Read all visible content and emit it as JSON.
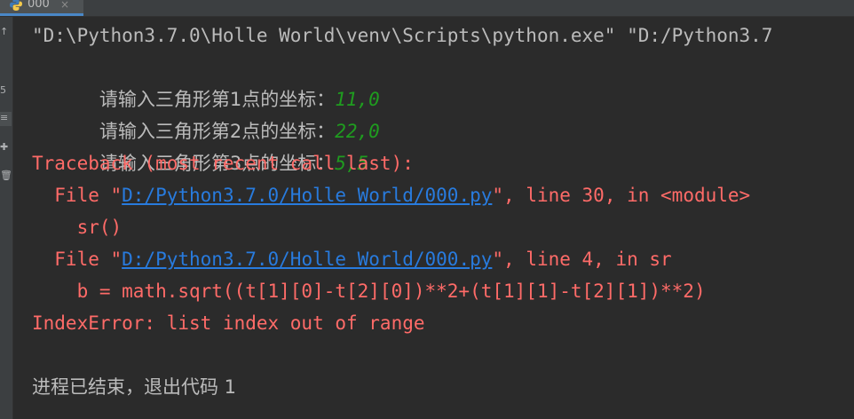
{
  "tab": {
    "label": "000",
    "close": "×",
    "icon": "python-file-icon"
  },
  "toolbar": {
    "icons": [
      "arrow-icon",
      "wrap-icon",
      "stack-icon",
      "pin-icon",
      "trash-icon"
    ],
    "glyphs": [
      "↑",
      "5",
      "≡",
      "✚",
      "🗑"
    ]
  },
  "colors": {
    "background": "#2b2b2b",
    "normal_text": "#bbbbbb",
    "input_text": "#1f9c1f",
    "error_text": "#ff6b68",
    "link": "#287bde"
  },
  "console": {
    "command": "\"D:\\Python3.7.0\\Holle World\\venv\\Scripts\\python.exe\" \"D:/Python3.7",
    "prompts": [
      {
        "label": "请输入三角形第1点的坐标：",
        "input": "11,0"
      },
      {
        "label": "请输入三角形第2点的坐标：",
        "input": "22,0"
      },
      {
        "label": "请输入三角形第3点的坐标：",
        "input": "5,5"
      }
    ],
    "traceback_header": "Traceback (most recent call last):",
    "frames": [
      {
        "prefix": "  File \"",
        "path": "D:/Python3.7.0/Holle World/000.py",
        "suffix": "\", line 30, in <module>",
        "code": "    sr()"
      },
      {
        "prefix": "  File \"",
        "path": "D:/Python3.7.0/Holle World/000.py",
        "suffix": "\", line 4, in sr",
        "code": "    b = math.sqrt((t[1][0]-t[2][0])**2+(t[1][1]-t[2][1])**2)"
      }
    ],
    "error": "IndexError: list index out of range",
    "exit_message": "进程已结束，退出代码 1"
  }
}
